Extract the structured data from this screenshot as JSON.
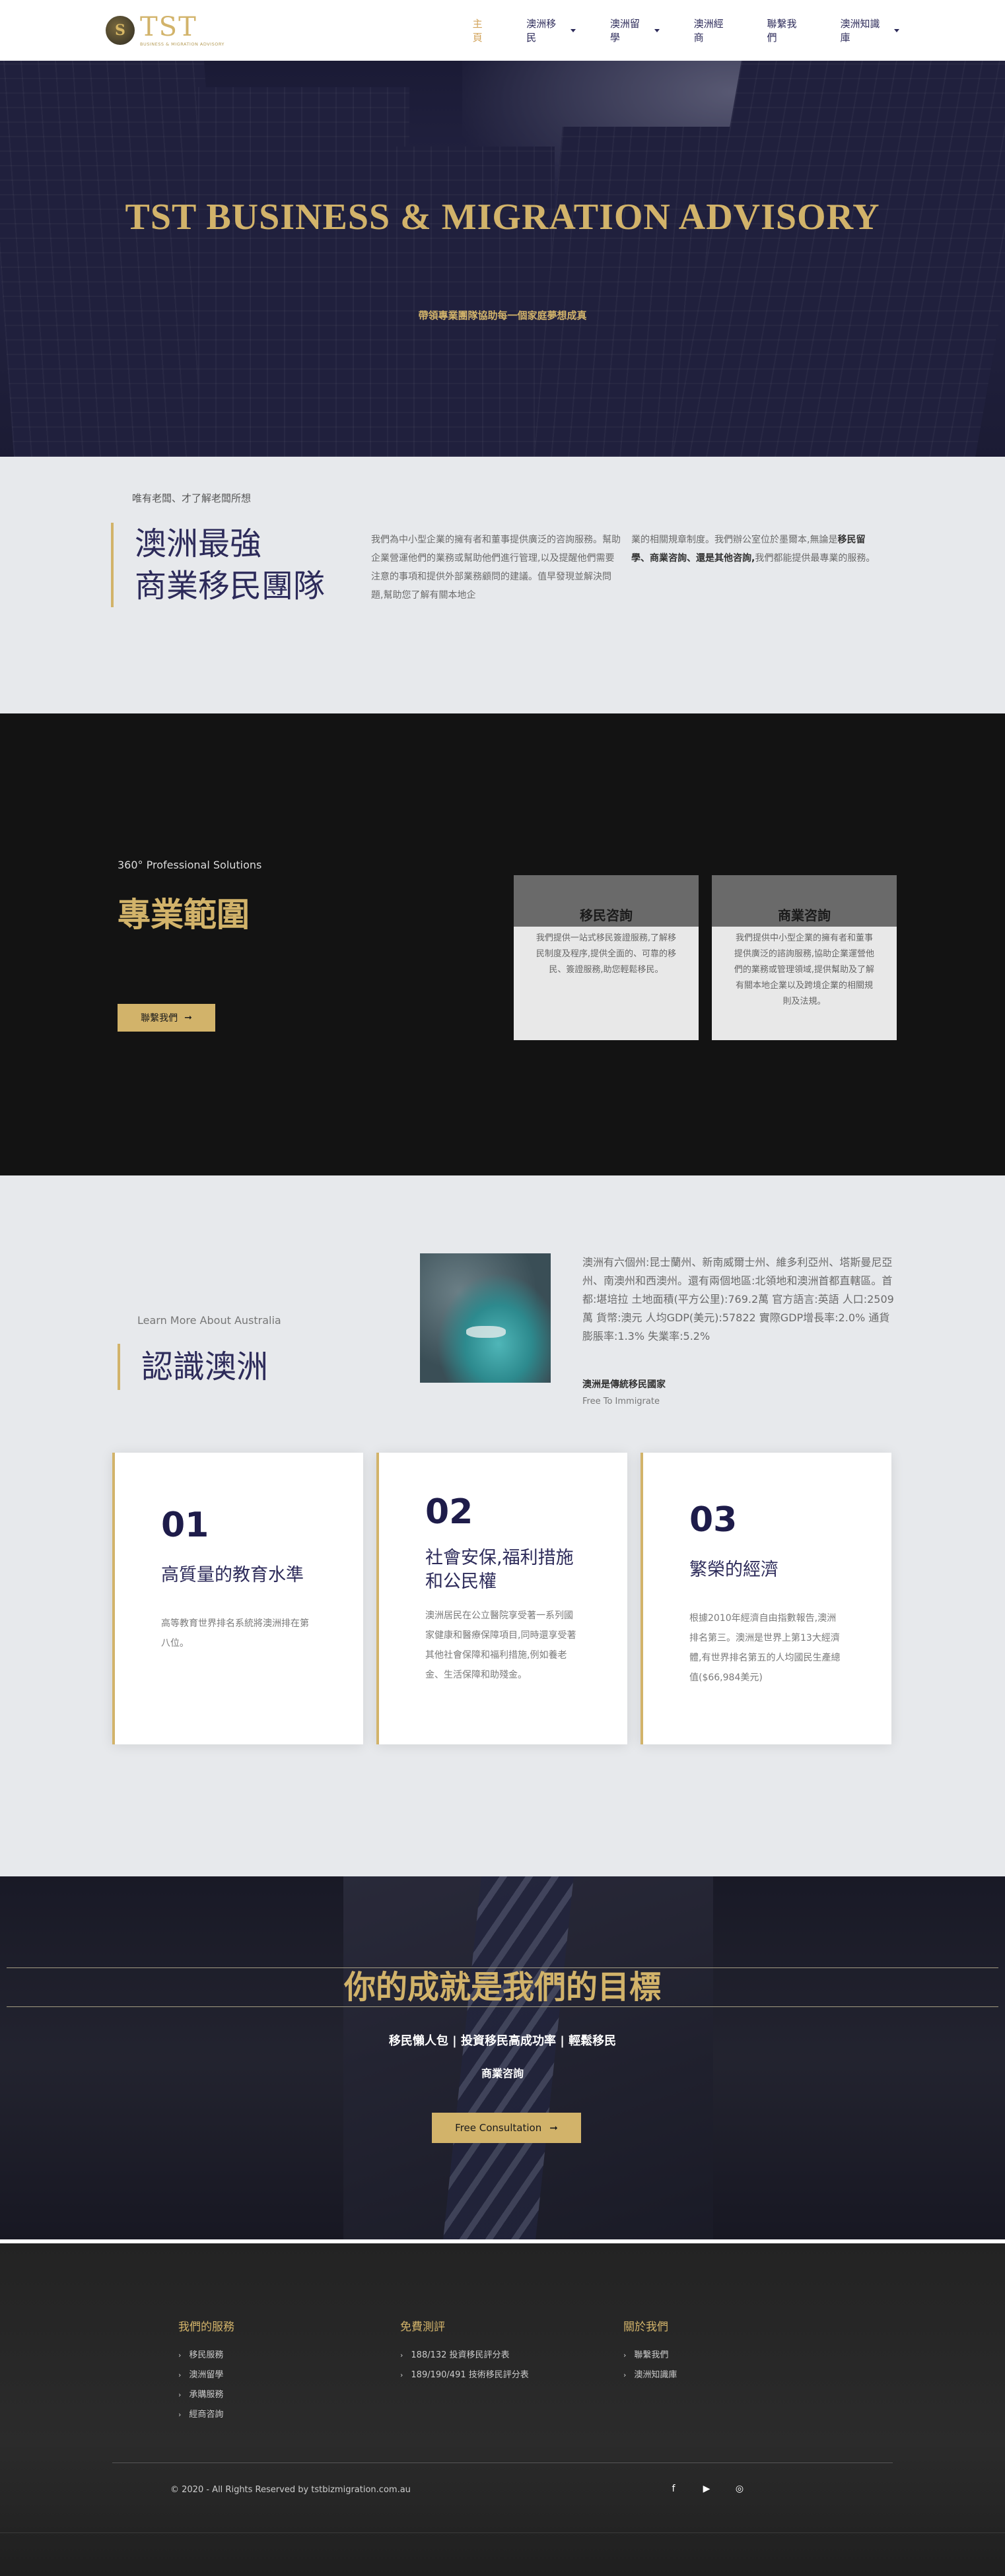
{
  "header": {
    "logo_mark": "S",
    "logo_word": "TST",
    "logo_sub": "BUSINESS & MIGRATION ADVISORY",
    "nav": [
      {
        "label": "主頁",
        "active": true,
        "has_dropdown": false
      },
      {
        "label": "澳洲移民",
        "active": false,
        "has_dropdown": true
      },
      {
        "label": "澳洲留學",
        "active": false,
        "has_dropdown": true
      },
      {
        "label": "澳洲經商",
        "active": false,
        "has_dropdown": false
      },
      {
        "label": "聯繫我們",
        "active": false,
        "has_dropdown": false
      },
      {
        "label": "澳洲知識庫",
        "active": false,
        "has_dropdown": true
      }
    ]
  },
  "hero": {
    "title": "TST BUSINESS & MIGRATION ADVISORY",
    "subtitle": "帶領專業團隊協助每一個家庭夢想成真"
  },
  "intro": {
    "eyebrow": "唯有老闆、才了解老闆所想",
    "heading_line1": "澳洲最強",
    "heading_line2": "商業移民團隊",
    "text_col1": "我們為中小型企業的擁有者和董事提供廣泛的咨詢服務。幫助企業營運他們的業務或幫助他們進行管理,以及提醒他們需要注意的事項和提供外部業務顧問的建議。值早發現並解決問題,幫助您了解有關本地企",
    "text_col2_a": "業的相關規章制度。我們辦公室位於墨爾本,無論是",
    "text_col2_bold": "移民留學、商業咨詢、還是其他咨詢,",
    "text_col2_b": "我們都能提供最專業的服務。"
  },
  "services": {
    "eyebrow": "360° Professional Solutions",
    "heading": "專業範圍",
    "button_label": "聯繫我們",
    "cards": [
      {
        "title": "移民咨詢",
        "text": "我們提供一站式移民簽證服務,了解移民制度及程序,提供全面的、可靠的移民、簽證服務,助您輕鬆移民。"
      },
      {
        "title": "商業咨詢",
        "text": "我們提供中小型企業的擁有者和董事提供廣泛的諮詢服務,協助企業運營他們的業務或管理領域,提供幫助及了解有關本地企業以及跨境企業的相關規則及法規。"
      }
    ]
  },
  "about": {
    "eyebrow": "Learn More About Australia",
    "heading": "認識澳洲",
    "text": "澳洲有六個州:昆士蘭州、新南威爾士州、維多利亞州、塔斯曼尼亞州、南澳州和西澳州。還有兩個地區:北領地和澳洲首都直轄區。首都:堪培拉 土地面積(平方公里):769.2萬 官方語言:英語 人口:2509萬 貨幣:澳元 人均GDP(美元):57822 實際GDP增長率:2.0% 通貨膨脹率:1.3% 失業率:5.2%",
    "bold_line": "澳洲是傳統移民國家",
    "small_line": "Free To Immigrate",
    "features": [
      {
        "num": "01",
        "title": "高質量的教育水準",
        "text": "高等教育世界排名系統將澳洲排在第八位。"
      },
      {
        "num": "02",
        "title": "社會安保,福利措施和公民權",
        "text": "澳洲居民在公立醫院享受著一系列國家健康和醫療保障項目,同時還享受著其他社會保障和福利措施,例如養老金、生活保障和助殘金。"
      },
      {
        "num": "03",
        "title": "繁榮的經濟",
        "text": "根據2010年經濟自由指數報告,澳洲排名第三。澳洲是世界上第13大經濟體,有世界排名第五的人均國民生產總值($66,984美元)"
      }
    ]
  },
  "cta": {
    "heading": "你的成就是我們的目標",
    "line1": "移民懶人包 | 投資移民高成功率 | 輕鬆移民",
    "line2": "商業咨詢",
    "button_label": "Free Consultation"
  },
  "footer": {
    "columns": [
      {
        "title": "我們的服務",
        "items": [
          "移民服務",
          "澳洲留學",
          "承購服務",
          "經商咨詢"
        ]
      },
      {
        "title": "免費測評",
        "items": [
          "188/132 投資移民評分表",
          "189/190/491 技術移民評分表"
        ]
      },
      {
        "title": "關於我們",
        "items": [
          "聯繫我們",
          "澳洲知識庫"
        ]
      }
    ],
    "copyright": "© 2020 - All Rights Reserved by tstbizmigration.com.au",
    "socials": [
      "facebook-icon",
      "youtube-icon",
      "instagram-icon"
    ]
  }
}
